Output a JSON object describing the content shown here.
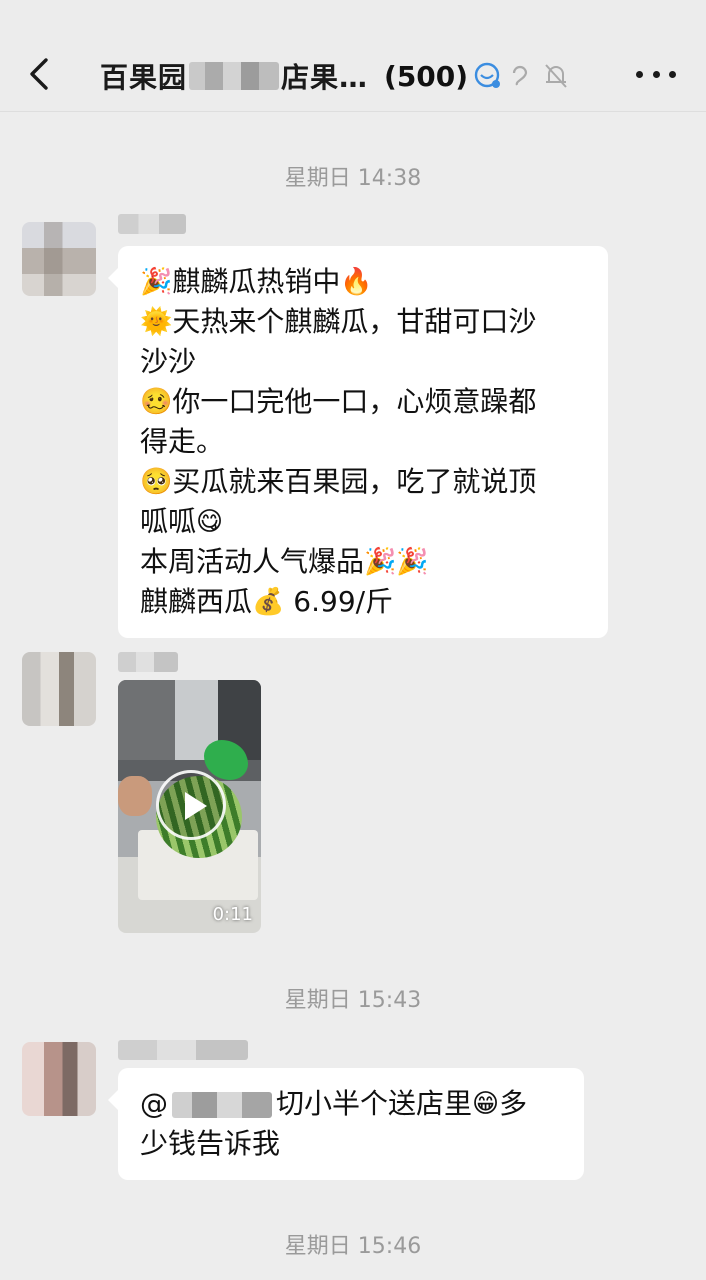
{
  "header": {
    "title_prefix": "百果园",
    "title_suffix": "店果…",
    "member_count": "(500)",
    "icons": [
      "back-icon",
      "group-bot-icon",
      "ear-icon",
      "mute-bell-icon",
      "more-icon"
    ]
  },
  "timestamps": [
    "星期日 14:38",
    "星期日 15:43",
    "星期日 15:46"
  ],
  "messages": [
    {
      "type": "text",
      "lines": [
        {
          "emoji": "🎉",
          "text": "麒麟瓜热销中",
          "emoji_after": "🔥"
        },
        {
          "emoji": "🌞",
          "text": "天热来个麒麟瓜，甘甜可口沙"
        },
        {
          "text": "沙沙"
        },
        {
          "emoji": "🥴",
          "text": "你一口完他一口，心烦意躁都"
        },
        {
          "text": "得走。"
        },
        {
          "emoji": "🥺",
          "text": "买瓜就来百果园，吃了就说顶"
        },
        {
          "text": "呱呱",
          "emoji_after": "😋"
        },
        {
          "text": "本周活动人气爆品",
          "emoji_after": "🎉🎉"
        },
        {
          "text": "麒麟西瓜",
          "emoji_after": "💰",
          "text_after": " 6.99/斤"
        }
      ]
    },
    {
      "type": "video",
      "duration": "0:11"
    },
    {
      "type": "text",
      "mention_prefix": "@",
      "line1": "切小半个送店里",
      "line1_emoji": "😁",
      "line1_tail": "多",
      "line2": "少钱告诉我"
    }
  ]
}
